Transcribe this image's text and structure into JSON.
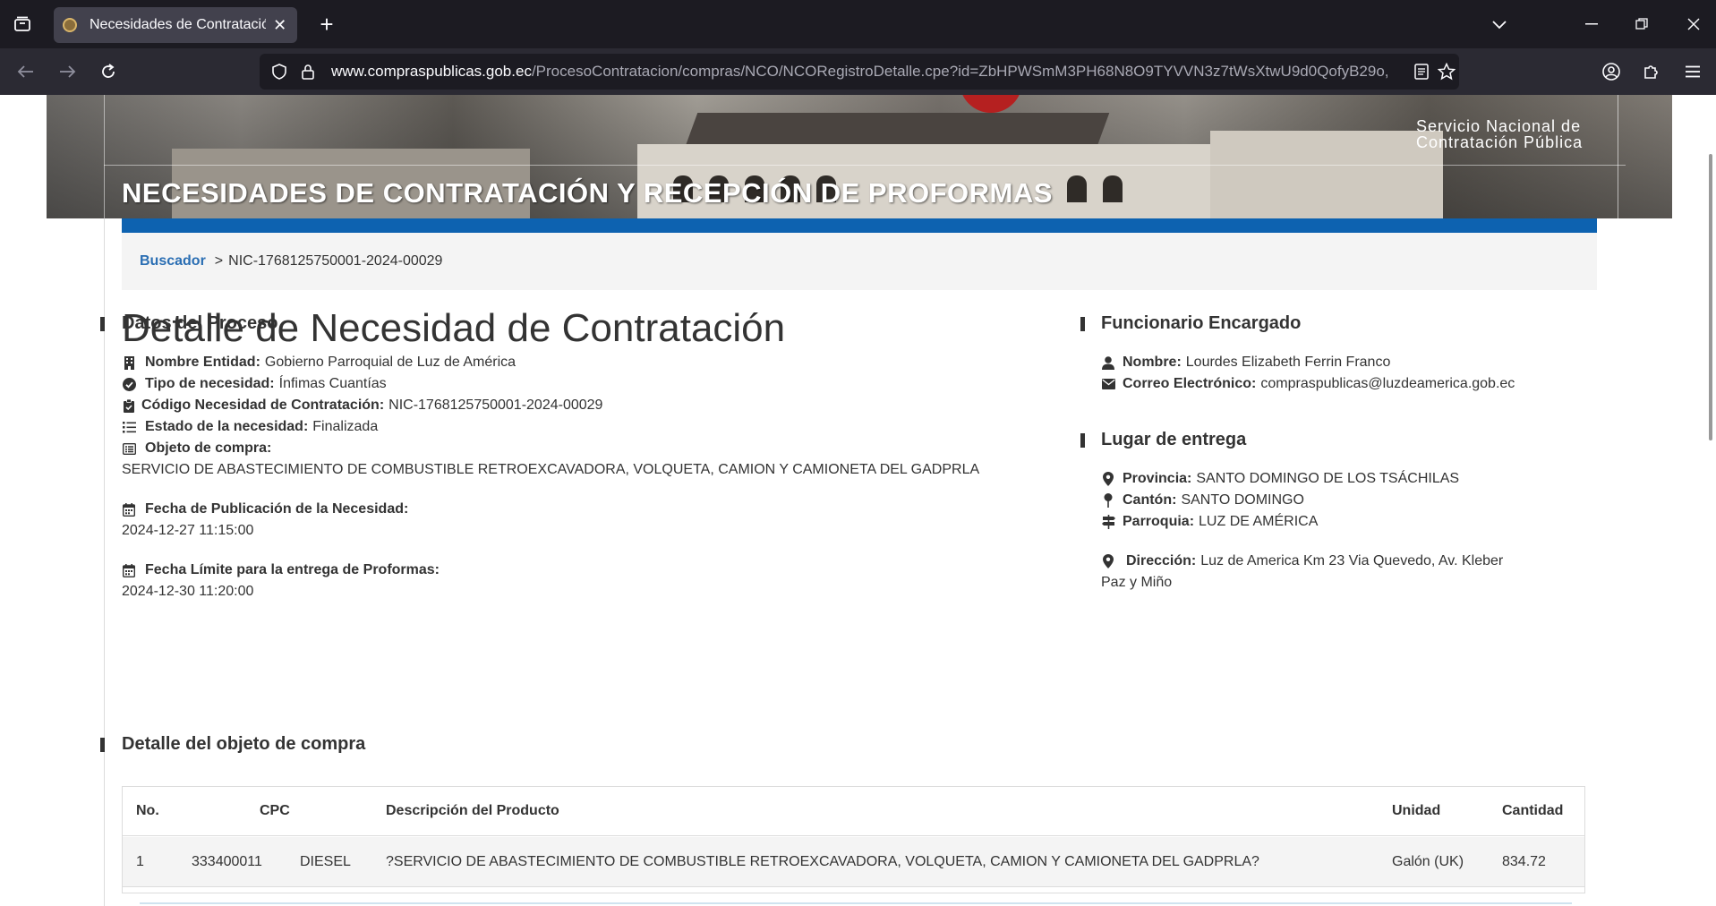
{
  "browser": {
    "tab_title": "Necesidades de Contratación y",
    "url_host": "www.compraspublicas.gob.ec",
    "url_path": "/ProcesoContratacion/compras/NCO/NCORegistroDetalle.cpe?id=ZbHPWSmM3PH68N8O9TYVVN3z7tWsXtwU9d0QofyB29o,"
  },
  "banner": {
    "org_line1": "Servicio Nacional de",
    "org_line2": "Contratación Pública",
    "title": "NECESIDADES DE CONTRATACIÓN Y RECEPCIÓN DE PROFORMAS"
  },
  "breadcrumb": {
    "link": "Buscador",
    "separator": ">",
    "current": "NIC-1768125750001-2024-00029"
  },
  "page_title": "Detalle de Necesidad de Contratación",
  "datos_proceso": {
    "heading": "Datos del Proceso",
    "nombre_entidad_label": "Nombre Entidad:",
    "nombre_entidad": "Gobierno Parroquial de Luz de América",
    "tipo_label": "Tipo de necesidad:",
    "tipo": "Ínfimas Cuantías",
    "codigo_label": "Código Necesidad de Contratación:",
    "codigo": "NIC-1768125750001-2024-00029",
    "estado_label": "Estado de la necesidad:",
    "estado": "Finalizada",
    "objeto_label": "Objeto de compra:",
    "objeto": "SERVICIO DE ABASTECIMIENTO DE COMBUSTIBLE RETROEXCAVADORA, VOLQUETA, CAMION Y CAMIONETA DEL GADPRLA",
    "fecha_pub_label": "Fecha de Publicación de la Necesidad:",
    "fecha_pub": "2024-12-27 11:15:00",
    "fecha_limite_label": "Fecha Límite para la entrega de Proformas:",
    "fecha_limite": "2024-12-30 11:20:00"
  },
  "funcionario": {
    "heading": "Funcionario Encargado",
    "nombre_label": "Nombre:",
    "nombre": "Lourdes Elizabeth Ferrin Franco",
    "correo_label": "Correo Electrónico:",
    "correo": "compraspublicas@luzdeamerica.gob.ec"
  },
  "lugar": {
    "heading": "Lugar de entrega",
    "provincia_label": "Provincia:",
    "provincia": "SANTO DOMINGO DE LOS TSÁCHILAS",
    "canton_label": "Cantón:",
    "canton": "SANTO DOMINGO",
    "parroquia_label": "Parroquia:",
    "parroquia": "LUZ DE AMÉRICA",
    "direccion_label": "Dirección:",
    "direccion_line1": "Luz de America Km 23 Via Quevedo, Av. Kleber",
    "direccion_line2": "Paz y Miño"
  },
  "detalle": {
    "heading": "Detalle del objeto de compra",
    "columns": {
      "no": "No.",
      "cpc": "CPC",
      "descripcion": "Descripción del Producto",
      "unidad": "Unidad",
      "cantidad": "Cantidad"
    },
    "rows": [
      {
        "no": "1",
        "cpc_code": "333400011",
        "cpc_name": "DIESEL",
        "descripcion": "?SERVICIO DE ABASTECIMIENTO DE COMBUSTIBLE RETROEXCAVADORA, VOLQUETA, CAMION Y CAMIONETA DEL GADPRLA?",
        "unidad": "Galón (UK)",
        "cantidad": "834.72"
      }
    ]
  },
  "colors": {
    "accent_blue": "#0d62b0",
    "link_blue": "#2a6eb3",
    "chrome_dark": "#1c1b22"
  }
}
